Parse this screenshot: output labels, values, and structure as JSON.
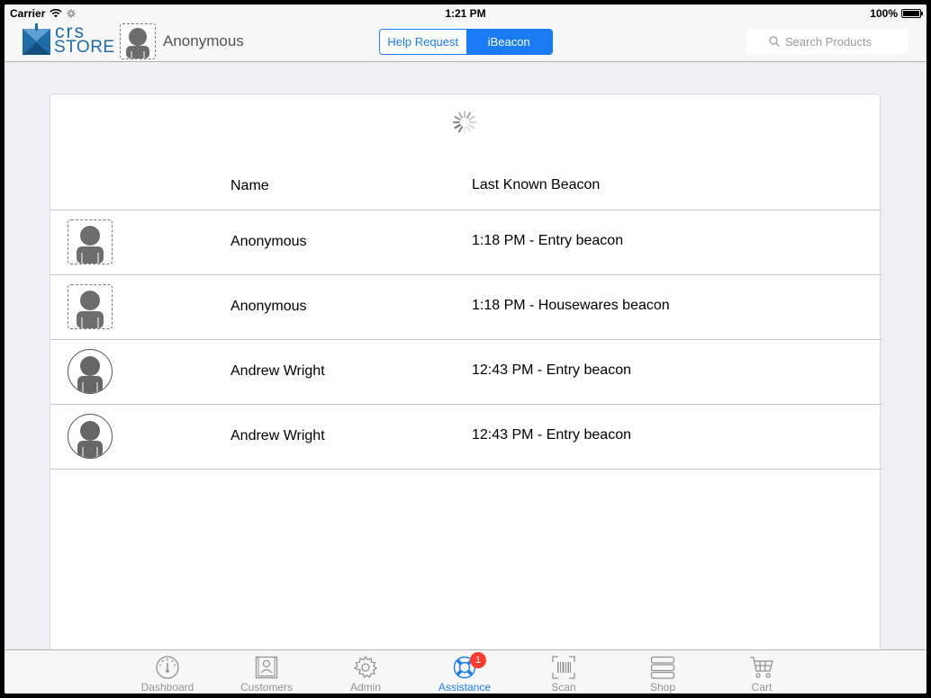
{
  "status_bar": {
    "carrier": "Carrier",
    "time": "1:21 PM",
    "battery": "100%",
    "battery_level": 1.0
  },
  "nav": {
    "logo_top": "crs",
    "logo_bottom": "STORE",
    "username": "Anonymous",
    "segments": [
      {
        "label": "Help Request",
        "selected": false
      },
      {
        "label": "iBeacon",
        "selected": true
      }
    ],
    "search_placeholder": "Search Products"
  },
  "table": {
    "headers": {
      "name": "Name",
      "beacon": "Last Known Beacon"
    },
    "rows": [
      {
        "name": "Anonymous",
        "beacon": "1:18 PM - Entry beacon",
        "avatar": "dashed"
      },
      {
        "name": "Anonymous",
        "beacon": "1:18 PM - Housewares beacon",
        "avatar": "dashed"
      },
      {
        "name": "Andrew Wright",
        "beacon": "12:43 PM - Entry beacon",
        "avatar": "round"
      },
      {
        "name": "Andrew Wright",
        "beacon": "12:43 PM - Entry beacon",
        "avatar": "round"
      }
    ]
  },
  "tab_bar": {
    "tabs": [
      {
        "label": "Dashboard",
        "icon": "dashboard-icon"
      },
      {
        "label": "Customers",
        "icon": "customers-icon"
      },
      {
        "label": "Admin",
        "icon": "gear-icon"
      },
      {
        "label": "Assistance",
        "icon": "lifebuoy-icon",
        "active": true,
        "badge": "1"
      },
      {
        "label": "Scan",
        "icon": "barcode-icon"
      },
      {
        "label": "Shop",
        "icon": "shop-icon"
      },
      {
        "label": "Cart",
        "icon": "cart-icon"
      }
    ]
  },
  "colors": {
    "accent": "#1a7cf5",
    "brand": "#1f6da8",
    "badge": "#ff3b30"
  }
}
